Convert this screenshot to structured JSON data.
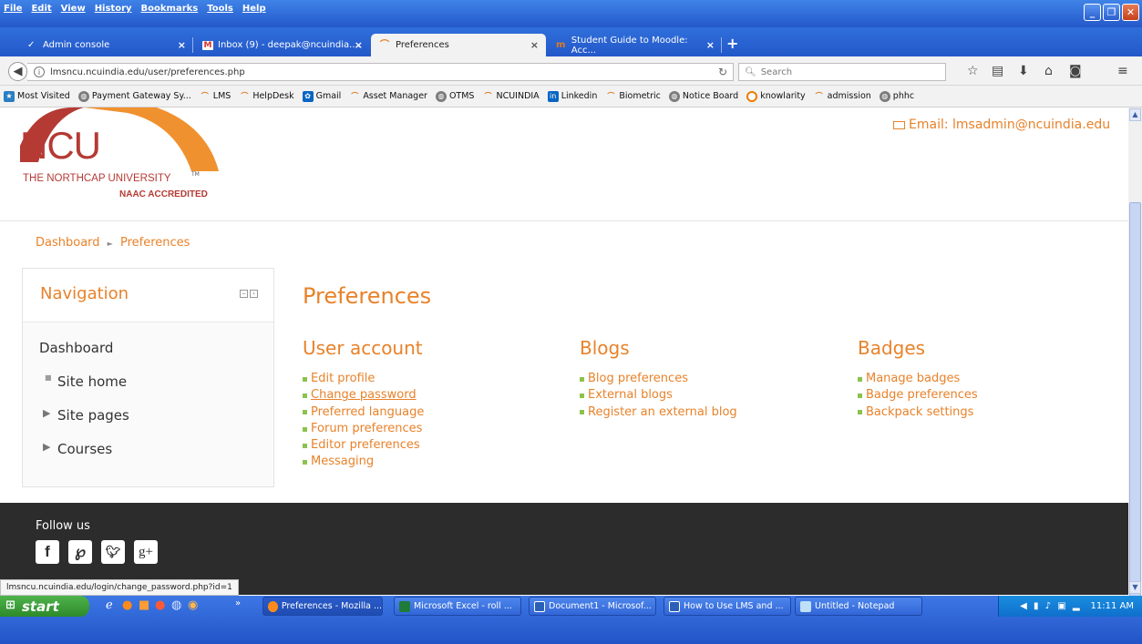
{
  "menubar": {
    "items": [
      "File",
      "Edit",
      "View",
      "History",
      "Bookmarks",
      "Tools",
      "Help"
    ]
  },
  "tabs": [
    {
      "label": "Admin console",
      "icon": "v-icon"
    },
    {
      "label": "Inbox (9) - deepak@ncuindia.... ",
      "icon": "gmail-icon"
    },
    {
      "label": "Preferences",
      "icon": "moodle-icon"
    },
    {
      "label": "Student Guide to Moodle: Acc...",
      "icon": "moodle-icon"
    }
  ],
  "nav": {
    "url": "lmsncu.ncuindia.edu/user/preferences.php",
    "search_placeholder": "Search"
  },
  "bookmarks": [
    {
      "label": "Most Visited",
      "icon": "globe"
    },
    {
      "label": "Payment Gateway Sy...",
      "icon": "globe"
    },
    {
      "label": "LMS",
      "icon": "moodle"
    },
    {
      "label": "HelpDesk",
      "icon": "moodle"
    },
    {
      "label": "Gmail",
      "icon": "gmail"
    },
    {
      "label": "Asset Manager",
      "icon": "moodle"
    },
    {
      "label": "OTMS",
      "icon": "globe"
    },
    {
      "label": "NCUINDIA",
      "icon": "moodle"
    },
    {
      "label": "Linkedin",
      "icon": "linkedin"
    },
    {
      "label": "Biometric",
      "icon": "moodle"
    },
    {
      "label": "Notice Board",
      "icon": "globe"
    },
    {
      "label": "knowlarity",
      "icon": "knowlarity"
    },
    {
      "label": "admission",
      "icon": "moodle"
    },
    {
      "label": "phhc",
      "icon": "globe"
    }
  ],
  "header": {
    "logo_text": "NCU",
    "logo_sub": "THE NORTHCAP UNIVERSITY",
    "logo_tm": "TM",
    "logo_naac": "NAAC ACCREDITED",
    "email": "Email: lmsadmin@ncuindia.edu"
  },
  "breadcrumb": {
    "first": "Dashboard",
    "sep": "►",
    "current": "Preferences"
  },
  "navigation": {
    "title": "Navigation",
    "items": [
      "Dashboard",
      "Site home",
      "Site pages",
      "Courses"
    ]
  },
  "page_title": "Preferences",
  "sections": [
    {
      "title": "User account",
      "links": [
        "Edit profile",
        "Change password",
        "Preferred language",
        "Forum preferences",
        "Editor preferences",
        "Messaging"
      ]
    },
    {
      "title": "Blogs",
      "links": [
        "Blog preferences",
        "External blogs",
        "Register an external blog"
      ]
    },
    {
      "title": "Badges",
      "links": [
        "Manage badges",
        "Badge preferences",
        "Backpack settings"
      ]
    }
  ],
  "footer": {
    "follow": "Follow us"
  },
  "status_url": "lmsncu.ncuindia.edu/login/change_password.php?id=1",
  "taskbar": {
    "start": "start",
    "buttons": [
      "Preferences - Mozilla ...",
      "Microsoft Excel - roll ...",
      "Document1 - Microsof...",
      "How to Use LMS and ...",
      "Untitled - Notepad"
    ],
    "clock": "11:11 AM"
  },
  "colors": {
    "accent": "#e8822a",
    "bullet": "#8bc34a",
    "footer": "#2c2c2c"
  }
}
